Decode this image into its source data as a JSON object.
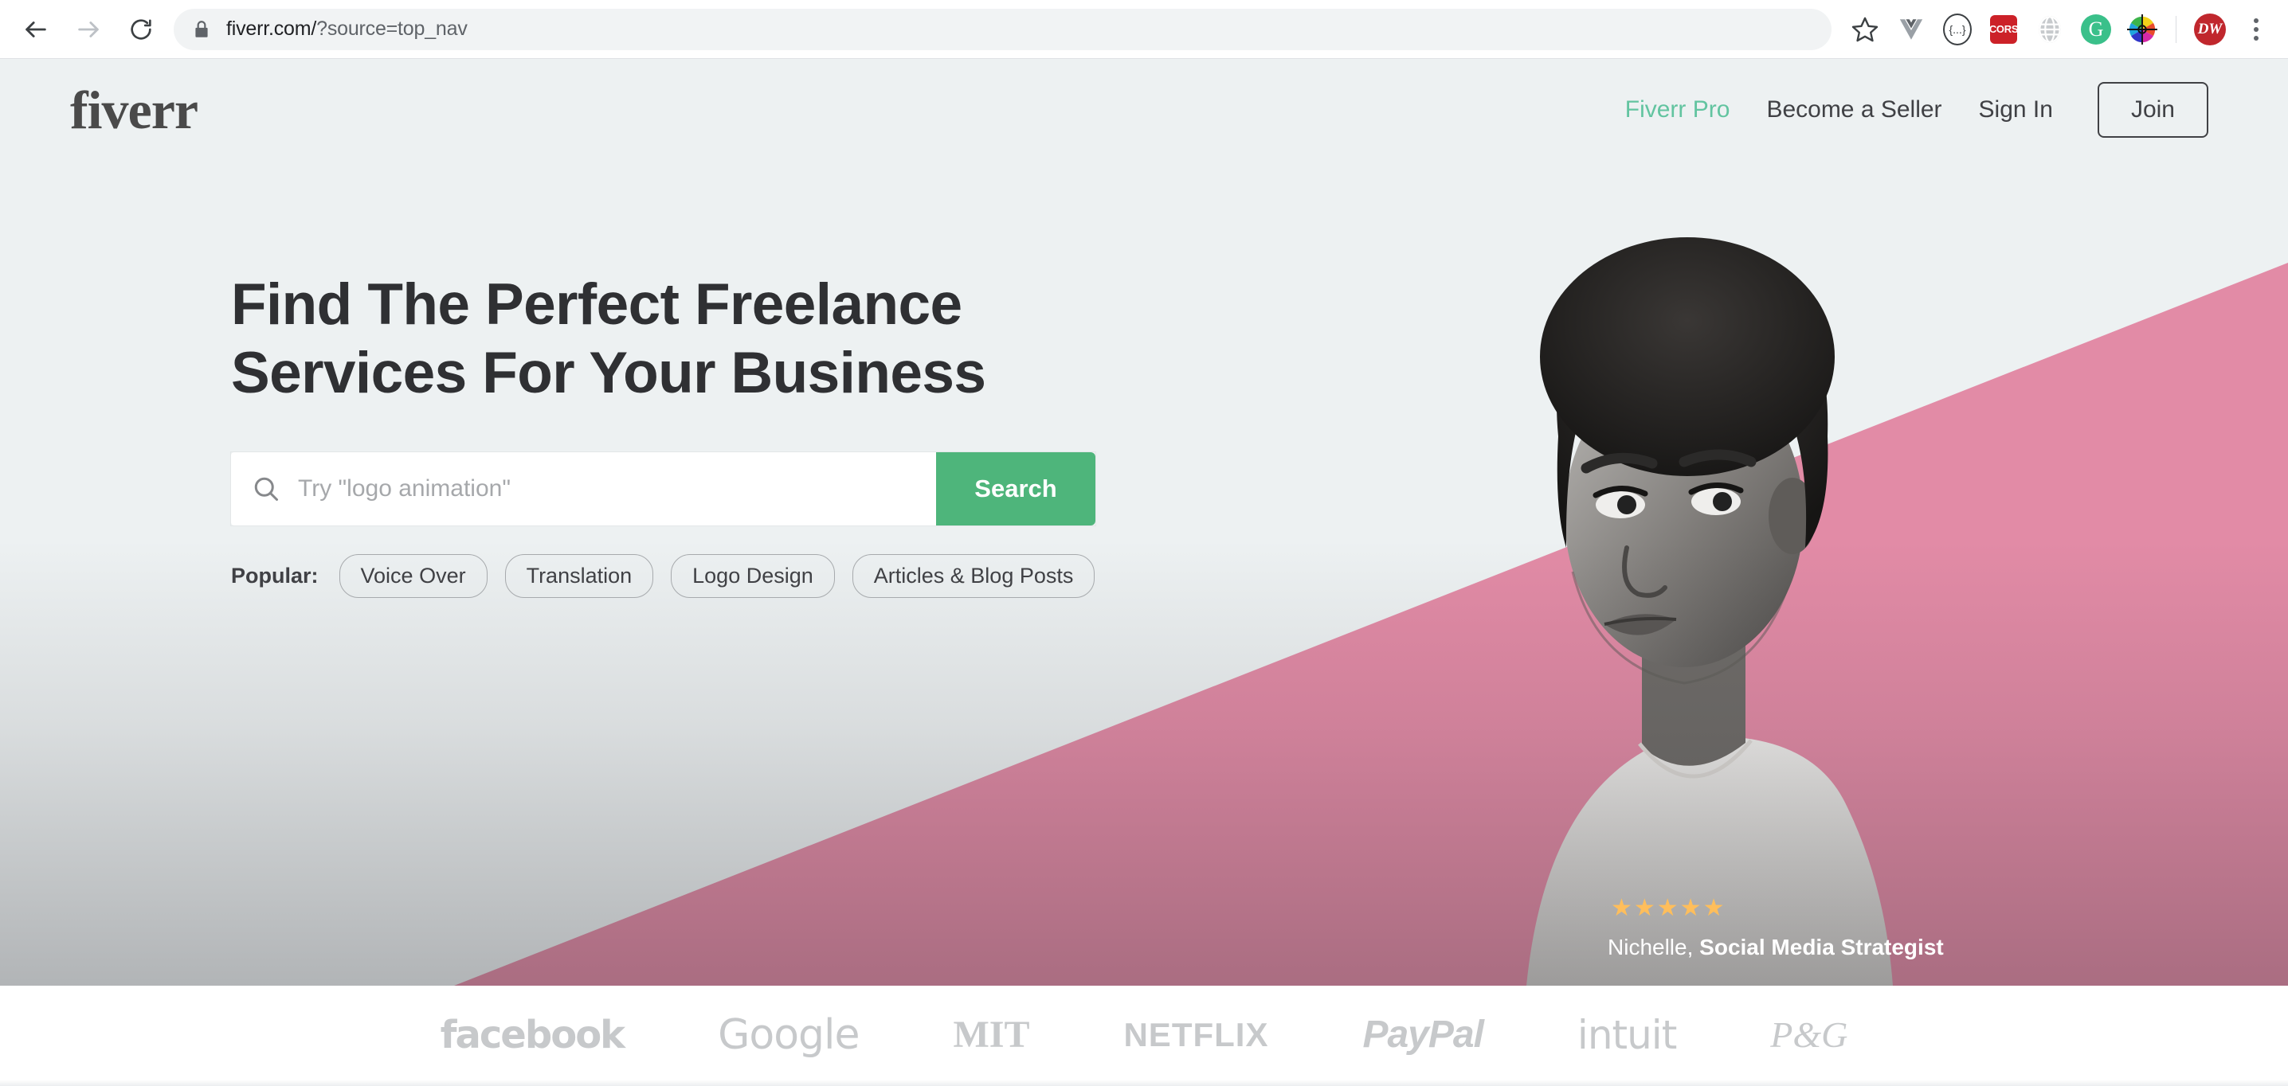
{
  "browser": {
    "back_icon": "back-arrow-icon",
    "forward_icon": "forward-arrow-icon",
    "reload_icon": "reload-icon",
    "lock_icon": "lock-icon",
    "url_main": "fiverr.com/",
    "url_query": "?source=top_nav",
    "bookmark_icon": "star-icon",
    "extensions": [
      {
        "name": "vue-devtools-icon",
        "label": "V"
      },
      {
        "name": "json-formatter-icon",
        "label": "{...}"
      },
      {
        "name": "cors-unblock-icon",
        "label": "CORS"
      },
      {
        "name": "globe-translate-icon",
        "label": "globe"
      },
      {
        "name": "grammarly-icon",
        "label": "G"
      },
      {
        "name": "color-picker-icon",
        "label": "color-wheel"
      },
      {
        "name": "dw-extension-icon",
        "label": "DW"
      }
    ],
    "menu_icon": "kebab-menu-icon"
  },
  "header": {
    "brand": "fiverr",
    "nav": [
      {
        "label": "Fiverr Pro",
        "accent": true
      },
      {
        "label": "Become a Seller",
        "accent": false
      },
      {
        "label": "Sign In",
        "accent": false
      }
    ],
    "join_label": "Join"
  },
  "hero": {
    "headline_line1": "Find The Perfect Freelance",
    "headline_line2": "Services For Your Business",
    "search": {
      "placeholder": "Try \"logo animation\"",
      "value": "",
      "button_label": "Search",
      "icon": "search-icon"
    },
    "popular_label": "Popular:",
    "tags": [
      "Voice Over",
      "Translation",
      "Logo Design",
      "Articles & Blog Posts"
    ],
    "testimonial": {
      "stars": "★★★★★",
      "rating": 5,
      "name": "Nichelle,",
      "role": "Social Media Strategist"
    }
  },
  "brands": [
    {
      "name": "facebook",
      "label": "facebook",
      "cls": "bl-facebook"
    },
    {
      "name": "google",
      "label": "Google",
      "cls": "bl-google"
    },
    {
      "name": "mit",
      "label": "MIT",
      "cls": "bl-mit"
    },
    {
      "name": "netflix",
      "label": "NETFLIX",
      "cls": "bl-netflix"
    },
    {
      "name": "paypal",
      "label": "PayPal",
      "cls": "bl-paypal"
    },
    {
      "name": "intuit",
      "label": "intuit",
      "cls": "bl-intuit"
    },
    {
      "name": "pg",
      "label": "P&G",
      "cls": "bl-pg"
    }
  ],
  "colors": {
    "hero_bg": "#edf1f2",
    "pink": "#e28ba6",
    "search_green": "#4eb57b",
    "pro_teal": "#62c4a0",
    "text_dark": "#404145",
    "star_gold": "#ffbe5b",
    "brand_gray": "#c7c9cb"
  }
}
